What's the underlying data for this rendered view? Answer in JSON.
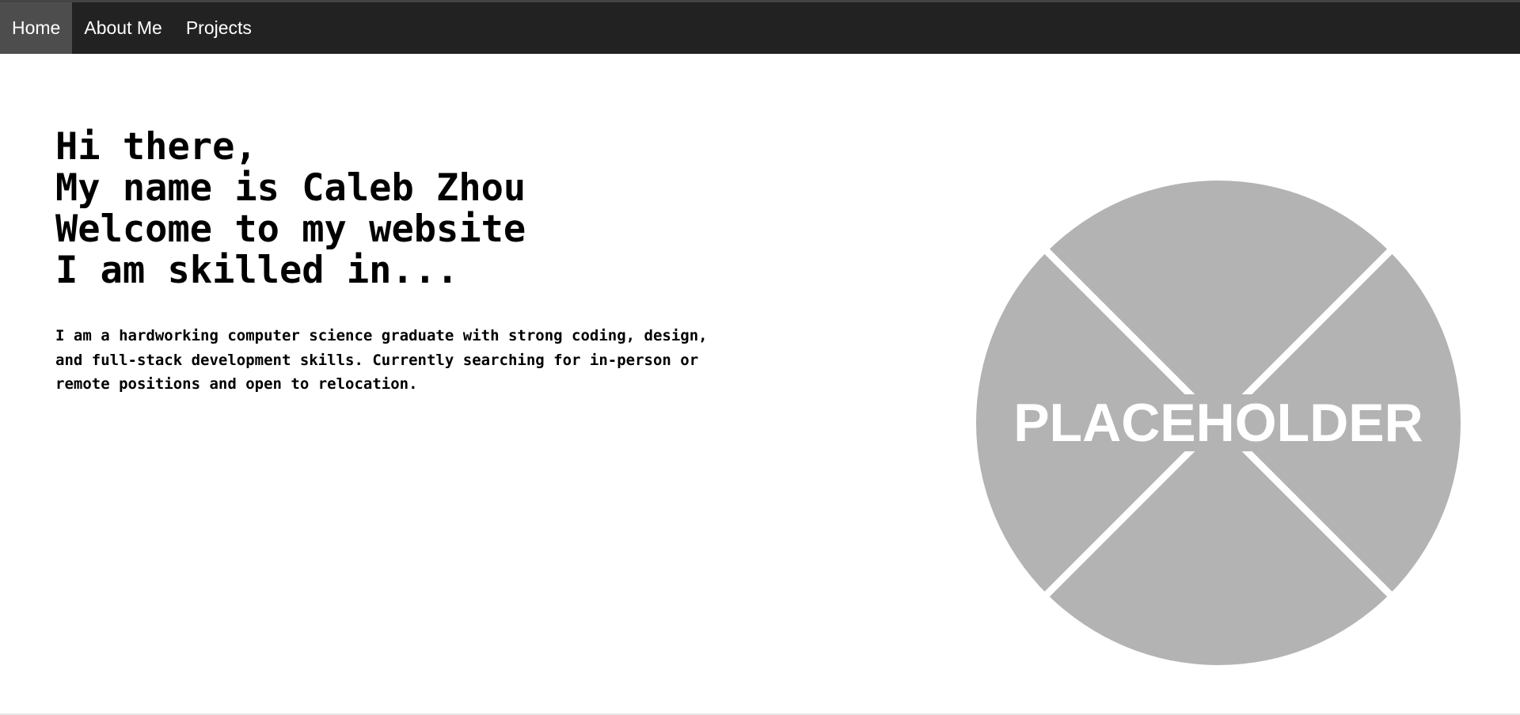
{
  "nav": {
    "items": [
      {
        "label": "Home",
        "active": true
      },
      {
        "label": "About Me",
        "active": false
      },
      {
        "label": "Projects",
        "active": false
      }
    ],
    "colors": {
      "bar": "#222222",
      "active": "#4d4d4d",
      "text": "#ffffff"
    }
  },
  "hero": {
    "lines": [
      "Hi there,",
      "My name is Caleb Zhou",
      "Welcome to my website",
      "I am skilled in..."
    ],
    "intro": "I am a hardworking computer science graduate with strong coding, design, and full-stack development skills. Currently searching for in-person or remote positions and open to relocation."
  },
  "image": {
    "label": "PLACEHOLDER",
    "fill": "#b3b3b3",
    "text_color": "#ffffff"
  }
}
